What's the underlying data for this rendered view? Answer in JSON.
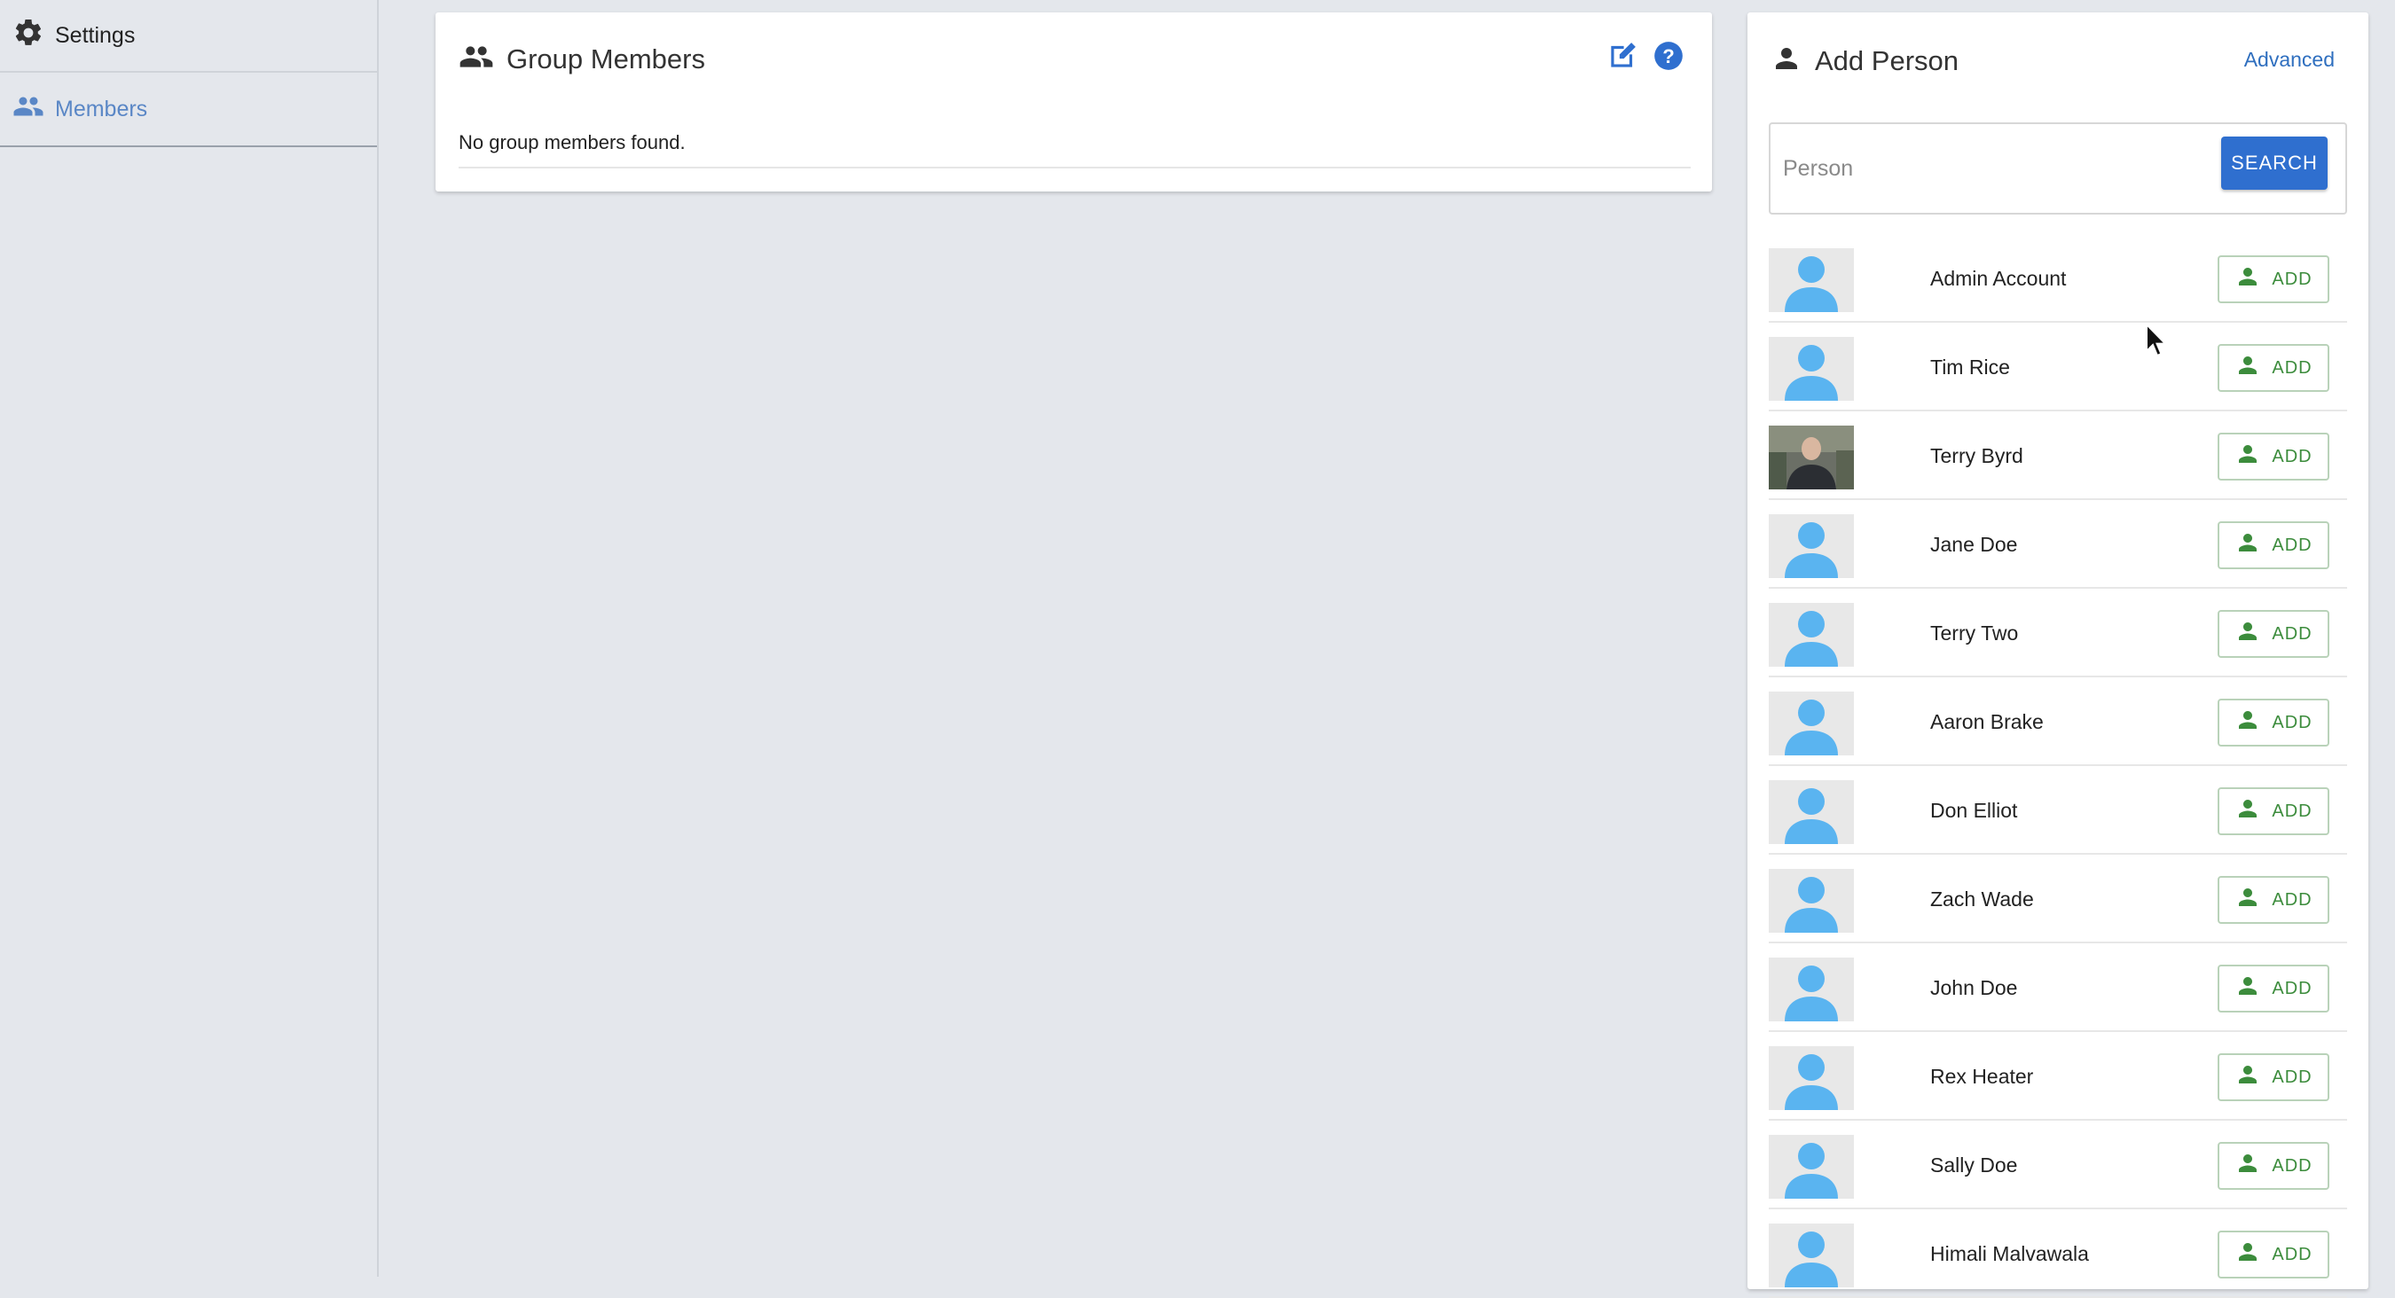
{
  "sidebar": {
    "items": [
      {
        "label": "Settings",
        "icon": "gear-icon"
      },
      {
        "label": "Members",
        "icon": "people-icon",
        "active": true
      }
    ]
  },
  "group_members": {
    "title": "Group Members",
    "empty_text": "No group members found.",
    "edit_icon": "edit-icon",
    "help_icon": "help-icon"
  },
  "add_person": {
    "title": "Add Person",
    "advanced_label": "Advanced",
    "search_placeholder": "Person",
    "search_label": "SEARCH",
    "add_label": "ADD",
    "people": [
      {
        "name": "Admin Account",
        "photo": false
      },
      {
        "name": "Tim Rice",
        "photo": false
      },
      {
        "name": "Terry Byrd",
        "photo": true
      },
      {
        "name": "Jane Doe",
        "photo": false
      },
      {
        "name": "Terry Two",
        "photo": false
      },
      {
        "name": "Aaron Brake",
        "photo": false
      },
      {
        "name": "Don Elliot",
        "photo": false
      },
      {
        "name": "Zach Wade",
        "photo": false
      },
      {
        "name": "John Doe",
        "photo": false
      },
      {
        "name": "Rex Heater",
        "photo": false
      },
      {
        "name": "Sally Doe",
        "photo": false
      },
      {
        "name": "Himali Malvawala",
        "photo": false
      }
    ]
  },
  "colors": {
    "accent": "#2f6fcf",
    "add_green": "#3c8c3c",
    "avatar_blue": "#5ab4f0",
    "background": "#e4e7ec"
  }
}
